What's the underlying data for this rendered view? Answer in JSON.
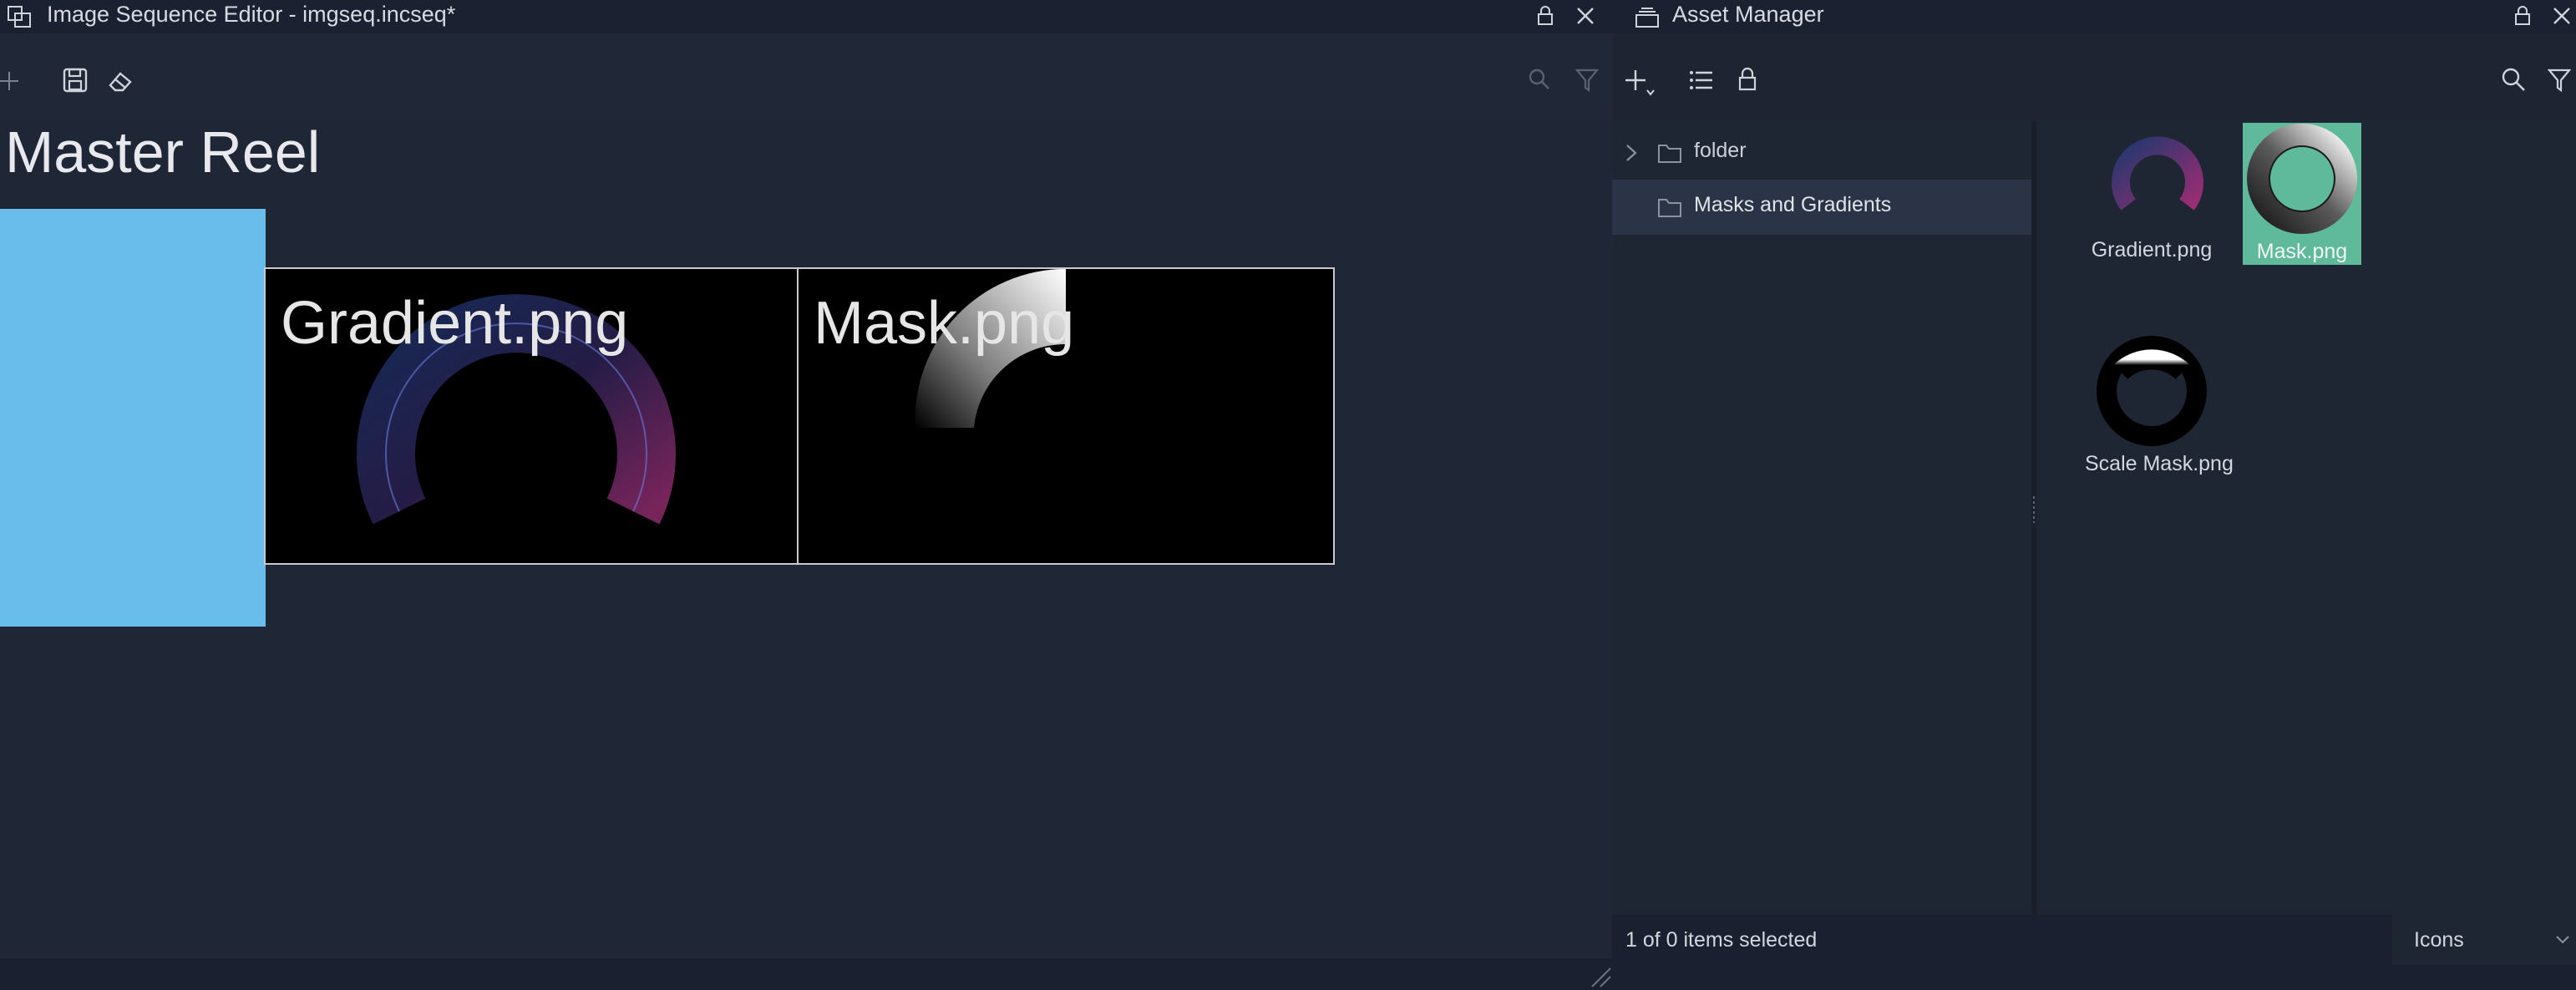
{
  "sequence_editor": {
    "title": "Image Sequence Editor - imgseq.incseq*",
    "reel_title": "Master Reel",
    "clips": [
      {
        "label": "Gradient.png"
      },
      {
        "label": "Mask.png"
      }
    ]
  },
  "asset_manager": {
    "title": "Asset Manager",
    "tree": [
      {
        "label": "folder",
        "expanded": false,
        "selected": false
      },
      {
        "label": "Masks and Gradients",
        "selected": true
      }
    ],
    "assets": [
      {
        "label": "Gradient.png",
        "selected": false
      },
      {
        "label": "Mask.png",
        "selected": true
      },
      {
        "label": "Scale Mask.png",
        "selected": false
      }
    ],
    "status": "1 of 0 items selected",
    "view_mode": "Icons"
  },
  "colors": {
    "panel_bg": "#202737",
    "reel_block": "#68bdeb",
    "selection_accent": "#5fba9b"
  }
}
